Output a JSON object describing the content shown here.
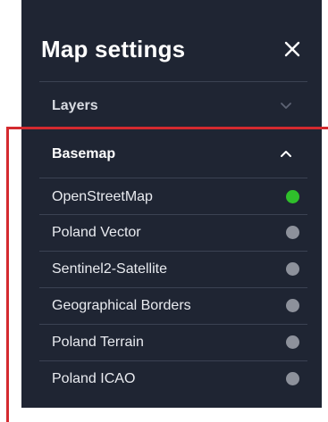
{
  "panel": {
    "title": "Map settings",
    "close_icon": "close-icon"
  },
  "sections": [
    {
      "label": "Layers",
      "expanded": false,
      "icon": "chevron-down-icon"
    },
    {
      "label": "Basemap",
      "expanded": true,
      "icon": "chevron-up-icon"
    }
  ],
  "basemaps": [
    {
      "label": "OpenStreetMap",
      "active": true
    },
    {
      "label": "Poland Vector",
      "active": false
    },
    {
      "label": "Sentinel2-Satellite",
      "active": false
    },
    {
      "label": "Geographical Borders",
      "active": false
    },
    {
      "label": "Poland Terrain",
      "active": false
    },
    {
      "label": "Poland ICAO",
      "active": false
    }
  ],
  "colors": {
    "panel_background": "#1f2533",
    "active_dot": "#2fbf2b",
    "inactive_dot": "#8d919b",
    "highlight_border": "#d42a2f"
  }
}
